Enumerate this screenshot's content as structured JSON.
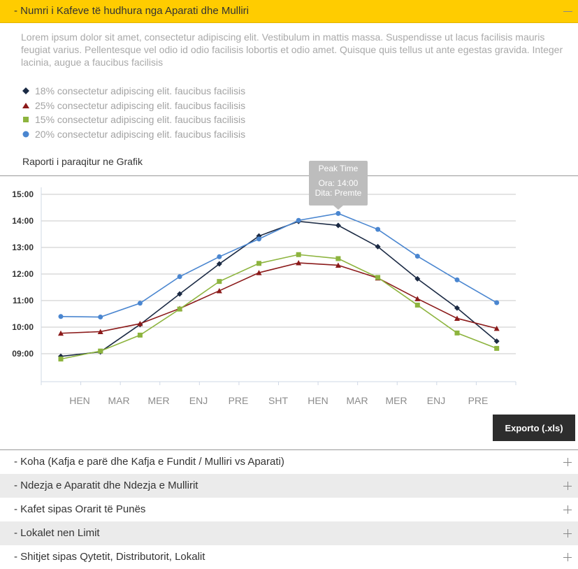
{
  "header": {
    "title": "- Numri i Kafeve të hudhura nga Aparati dhe Mulliri",
    "toggle_icon": "minus-icon"
  },
  "intro_text": "Lorem ipsum dolor sit amet, consectetur adipiscing elit. Vestibulum in mattis massa. Suspendisse ut lacus facilisis mauris feugiat varius. Pellentesque vel odio id odio facilisis lobortis et odio amet. Quisque quis tellus ut ante egestas gravida. Integer lacinia, augue a faucibus facilisis",
  "legend": [
    {
      "label": "18% consectetur adipiscing elit. faucibus facilisis",
      "marker": "diamond",
      "color": "#1b2a44"
    },
    {
      "label": "25% consectetur adipiscing elit. faucibus facilisis",
      "marker": "triangle",
      "color": "#8b1a1a"
    },
    {
      "label": "15% consectetur adipiscing elit. faucibus facilisis",
      "marker": "square",
      "color": "#8db43e"
    },
    {
      "label": "20% consectetur adipiscing elit. faucibus facilisis",
      "marker": "circle",
      "color": "#4a86d0"
    }
  ],
  "chart_title": "Raporti i paraqitur ne Grafik",
  "tooltip": {
    "title": "Peak Time",
    "line1": "Ora: 14:00",
    "line2": "Dita: Premte"
  },
  "export_label": "Exporto (.xls)",
  "chart_data": {
    "type": "line",
    "title": "Raporti i paraqitur ne Grafik",
    "x_tick_labels": [
      "HEN",
      "MAR",
      "MER",
      "ENJ",
      "PRE",
      "SHT",
      "HEN",
      "MAR",
      "MER",
      "ENJ",
      "PRE"
    ],
    "y_tick_labels": [
      "09:00",
      "10:00",
      "11:00",
      "12:00",
      "13:00",
      "14:00",
      "15:00"
    ],
    "ylim": [
      8.5,
      15.5
    ],
    "grid": true,
    "legend_position": "top-left",
    "series": [
      {
        "name": "18% consectetur adipiscing elit. faucibus facilisis",
        "marker": "diamond",
        "color": "#1b2a44",
        "values": [
          8.9,
          9.07,
          10.1,
          11.25,
          12.38,
          13.43,
          13.98,
          13.83,
          13.03,
          11.82,
          10.72,
          9.47
        ]
      },
      {
        "name": "25% consectetur adipiscing elit. faucibus facilisis",
        "marker": "triangle",
        "color": "#8b1a1a",
        "values": [
          9.77,
          9.83,
          10.13,
          10.7,
          11.37,
          12.05,
          12.42,
          12.33,
          11.85,
          11.07,
          10.33,
          9.95
        ]
      },
      {
        "name": "15% consectetur adipiscing elit. faucibus facilisis",
        "marker": "square",
        "color": "#8db43e",
        "values": [
          8.8,
          9.1,
          9.7,
          10.68,
          11.72,
          12.4,
          12.73,
          12.58,
          11.87,
          10.83,
          9.78,
          9.2
        ]
      },
      {
        "name": "20% consectetur adipiscing elit. faucibus facilisis",
        "marker": "circle",
        "color": "#4a86d0",
        "values": [
          10.4,
          10.38,
          10.9,
          11.9,
          12.65,
          13.32,
          14.02,
          14.28,
          13.68,
          12.67,
          11.78,
          10.92
        ]
      }
    ]
  },
  "accordion": [
    {
      "label": "- Koha (Kafja e parë dhe Kafja e Fundit / Mulliri vs Aparati)",
      "icon": "plus-icon"
    },
    {
      "label": "- Ndezja e Aparatit dhe Ndezja e Mullirit",
      "icon": "plus-icon"
    },
    {
      "label": "- Kafet sipas Orarit të Punës",
      "icon": "plus-icon"
    },
    {
      "label": "- Lokalet nen Limit",
      "icon": "plus-icon"
    },
    {
      "label": "- Shitjet sipas Qytetit, Distributorit, Lokalit",
      "icon": "plus-icon"
    }
  ]
}
